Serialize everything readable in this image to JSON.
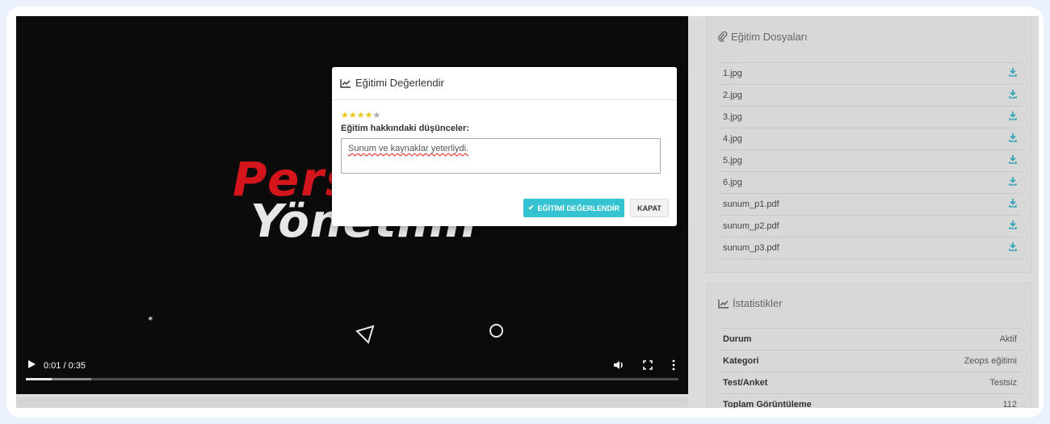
{
  "video": {
    "brand_line1": "Pers",
    "brand_line2": "Yönetimi",
    "time": "0:01 / 0:35",
    "progress_played": 0.04,
    "progress_buffered": 0.1
  },
  "modal": {
    "title": "Eğitimi Değerlendir",
    "rating": 4,
    "rating_max": 5,
    "comment_label": "Eğitim hakkındaki düşünceler:",
    "comment_value": "Sunum ve kaynaklar yeterliydi.",
    "submit_label": "EĞİTİMİ DEĞERLENDİR",
    "close_label": "KAPAT",
    "accent_color": "#35c3d1"
  },
  "files_panel": {
    "title": "Eğitim Dosyaları",
    "files": [
      "1.jpg",
      "2.jpg",
      "3.jpg",
      "4.jpg",
      "5.jpg",
      "6.jpg",
      "sunum_p1.pdf",
      "sunum_p2.pdf",
      "sunum_p3.pdf"
    ]
  },
  "stats_panel": {
    "title": "İstatistikler",
    "rows": [
      {
        "key": "Durum",
        "value": "Aktif"
      },
      {
        "key": "Kategori",
        "value": "Zeops eğitimi"
      },
      {
        "key": "Test/Anket",
        "value": "Testsiz"
      },
      {
        "key": "Toplam Görüntüleme",
        "value": "112"
      }
    ]
  }
}
